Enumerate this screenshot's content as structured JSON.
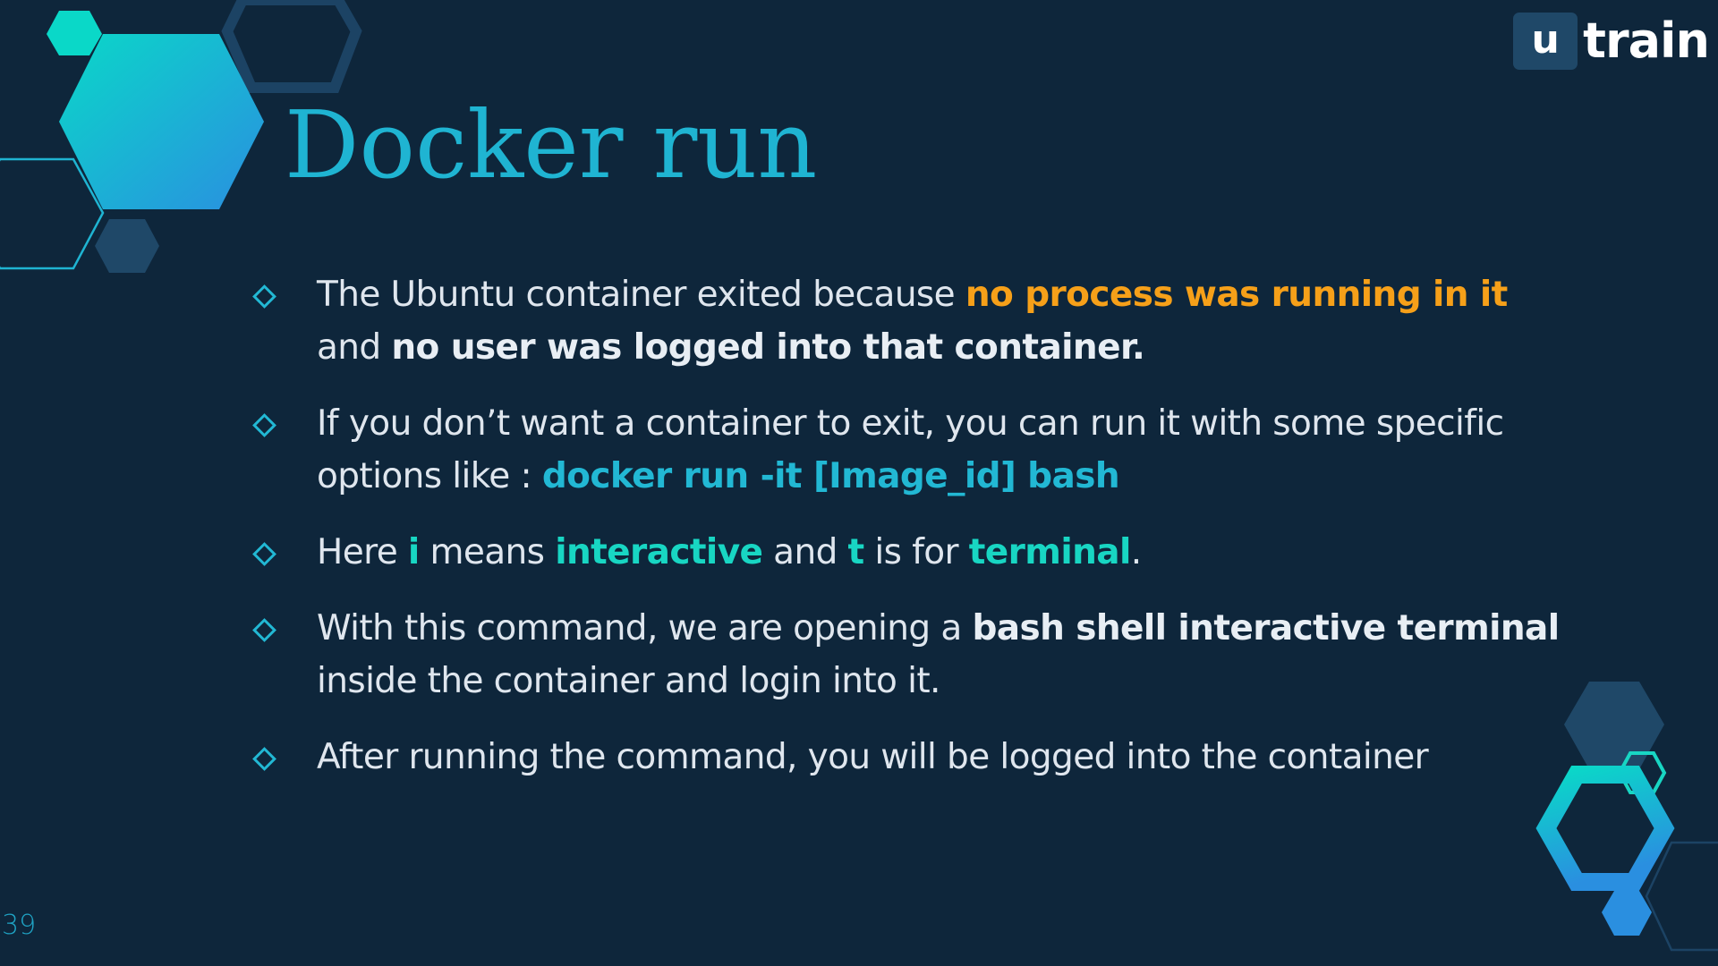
{
  "logo": {
    "mark": "u",
    "word": "train"
  },
  "title": "Docker run",
  "bullets": [
    {
      "segments": [
        {
          "text": "The Ubuntu container exited because ",
          "style": "plain"
        },
        {
          "text": "no process was running in it",
          "style": "orange"
        },
        {
          "text": " and ",
          "style": "plain"
        },
        {
          "text": "no user was logged into that container.",
          "style": "white"
        }
      ]
    },
    {
      "segments": [
        {
          "text": "If you don’t want a container to exit, you can run it with some specific options like : ",
          "style": "plain"
        },
        {
          "text": "docker run -it [Image_id] bash",
          "style": "cyan"
        }
      ]
    },
    {
      "segments": [
        {
          "text": "Here ",
          "style": "plain"
        },
        {
          "text": "i",
          "style": "green"
        },
        {
          "text": " means ",
          "style": "plain"
        },
        {
          "text": "interactive",
          "style": "green"
        },
        {
          "text": " and ",
          "style": "plain"
        },
        {
          "text": "t",
          "style": "green"
        },
        {
          "text": " is for ",
          "style": "plain"
        },
        {
          "text": "terminal",
          "style": "green"
        },
        {
          "text": ".",
          "style": "plain"
        }
      ]
    },
    {
      "segments": [
        {
          "text": "With this command, we are opening a ",
          "style": "plain"
        },
        {
          "text": "bash shell interactive terminal",
          "style": "white"
        },
        {
          "text": " inside the container and login into it.",
          "style": "plain"
        }
      ]
    },
    {
      "segments": [
        {
          "text": "After running the command, you will be logged into the container",
          "style": "plain"
        }
      ]
    }
  ],
  "page_number": "39",
  "colors": {
    "background": "#0e263b",
    "title": "#1fb4d2",
    "body_text": "#dfe6ee",
    "highlight_orange": "#f6a019",
    "highlight_cyan": "#22b8d4",
    "highlight_green": "#18d6c3",
    "hexagon_dark": "#1f4868"
  }
}
